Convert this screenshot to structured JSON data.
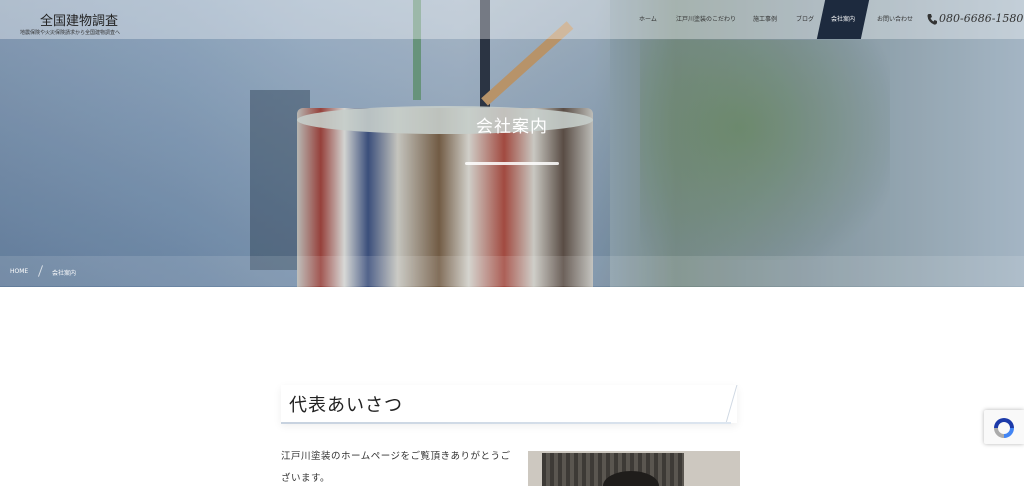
{
  "site": {
    "logo": "全国建物調査",
    "tagline": "地震保険や火災保険請求から全国建物調査へ",
    "phone": "080-6686-1580"
  },
  "nav": {
    "items": [
      {
        "label": "ホーム"
      },
      {
        "label": "江戸川塗装のこだわり"
      },
      {
        "label": "施工事例"
      },
      {
        "label": "ブログ"
      },
      {
        "label": "会社案内",
        "active": true
      },
      {
        "label": "お問い合わせ"
      }
    ]
  },
  "hero": {
    "title": "会社案内"
  },
  "breadcrumb": {
    "home": "HOME",
    "current": "会社案内"
  },
  "section": {
    "heading": "代表あいさつ",
    "paragraph": "江戸川塗装のホームページをご覧頂きありがとうございます。"
  },
  "icons": {
    "phone": "phone-icon",
    "recaptcha": "recaptcha-icon"
  },
  "colors": {
    "nav_active_bg": "#1d2a3e",
    "hero_tint": "#7f97b1",
    "heading_underline": "#c7d2df"
  }
}
